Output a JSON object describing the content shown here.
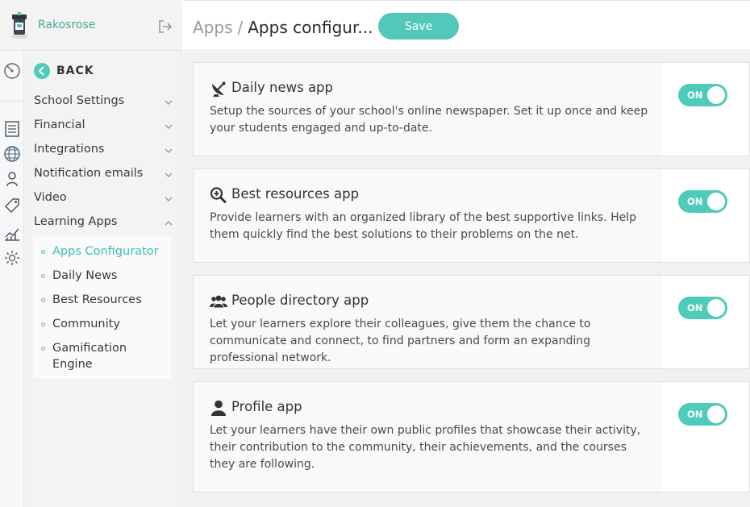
{
  "brand": {
    "name": "Rakosrose"
  },
  "header": {
    "breadcrumb_root": "Apps",
    "breadcrumb_sep": "/",
    "breadcrumb_current": "Apps configur...",
    "save_label": "Save"
  },
  "sidebar": {
    "back_label": "BACK",
    "menu": [
      {
        "label": "School Settings",
        "expanded": false
      },
      {
        "label": "Financial",
        "expanded": false
      },
      {
        "label": "Integrations",
        "expanded": false
      },
      {
        "label": "Notification emails",
        "expanded": false
      },
      {
        "label": "Video",
        "expanded": false
      },
      {
        "label": "Learning Apps",
        "expanded": true
      }
    ],
    "submenu": [
      {
        "label": "Apps Configurator",
        "active": true
      },
      {
        "label": "Daily News",
        "active": false
      },
      {
        "label": "Best Resources",
        "active": false
      },
      {
        "label": "Community",
        "active": false
      },
      {
        "label": "Gamification Engine",
        "active": false
      }
    ],
    "rail_icons": [
      "dashboard-icon",
      "document-icon",
      "globe-icon",
      "user-location-icon",
      "tag-icon",
      "chart-icon",
      "settings-icon"
    ]
  },
  "apps": [
    {
      "title": "Daily news app",
      "icon": "satellite-dish-icon",
      "description": "Setup the sources of your school's online newspaper. Set it up once and keep your students engaged and up-to-date.",
      "toggle_label": "ON",
      "enabled": true
    },
    {
      "title": "Best resources app",
      "icon": "search-plus-icon",
      "description": "Provide learners with an organized library of the best supportive links. Help them quickly find the best solutions to their problems on the net.",
      "toggle_label": "ON",
      "enabled": true
    },
    {
      "title": "People directory app",
      "icon": "users-icon",
      "description": "Let your learners explore their colleagues, give them the chance to communicate and connect, to find partners and form an expanding professional network.",
      "toggle_label": "ON",
      "enabled": true
    },
    {
      "title": "Profile app",
      "icon": "user-icon",
      "description": "Let your learners have their own public profiles that showcase their activity, their contribution to the community, their achievements, and the courses they are following.",
      "toggle_label": "ON",
      "enabled": true
    }
  ],
  "colors": {
    "accent": "#4ecbb9",
    "active_text": "#3dbfae",
    "brand_text": "#4aa89a"
  }
}
